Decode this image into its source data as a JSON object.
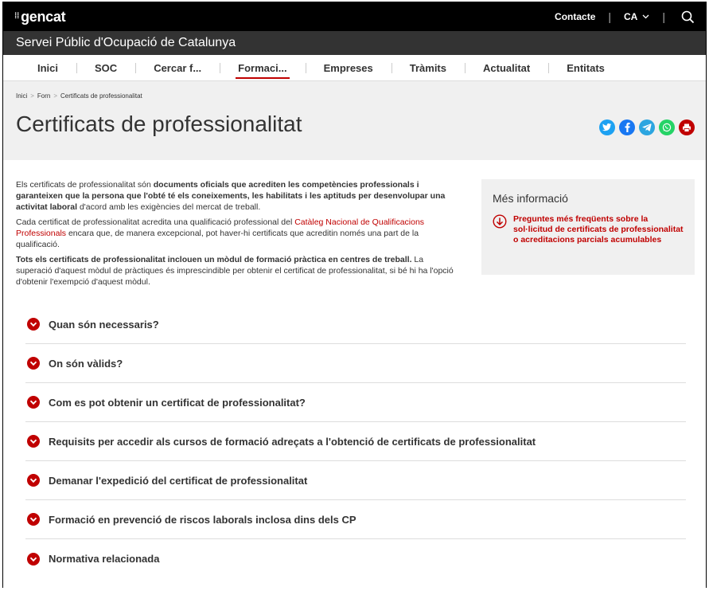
{
  "topbar": {
    "logo": "gencat",
    "contact": "Contacte",
    "language": "CA"
  },
  "subbar": {
    "title": "Servei Públic d'Ocupació de Catalunya"
  },
  "nav": {
    "items": [
      {
        "label": "Inici"
      },
      {
        "label": "SOC"
      },
      {
        "label": "Cercar f..."
      },
      {
        "label": "Formaci..."
      },
      {
        "label": "Empreses"
      },
      {
        "label": "Tràmits"
      },
      {
        "label": "Actualitat"
      },
      {
        "label": "Entitats"
      }
    ]
  },
  "breadcrumb": [
    "Inici",
    "Forn",
    "Certificats de professionalitat"
  ],
  "page_title": "Certificats de professionalitat",
  "share_colors": {
    "twitter": "#1da1f2",
    "facebook": "#1877f2",
    "telegram": "#2ca5e0",
    "whatsapp": "#25d366",
    "print": "#c00000"
  },
  "intro": {
    "p1_a": "Els certificats de professionalitat són ",
    "p1_b": "documents oficials que acrediten les competències professionals i garanteixen que la persona que l'obté té els coneixements, les habilitats i les aptituds per desenvolupar una activitat laboral",
    "p1_c": " d'acord amb les exigències del mercat de treball.",
    "p2_a": "Cada certificat de professionalitat acredita una qualificació professional del ",
    "p2_link": "Catàleg Nacional de Qualificacions Professionals",
    "p2_b": " encara que, de manera excepcional, pot haver-hi certificats que acreditin només una part de la qualificació.",
    "p3_a": "Tots els certificats de professionalitat inclouen un mòdul de formació pràctica en centres de treball.",
    "p3_b": " La superació d'aquest mòdul de pràctiques és imprescindible per obtenir el certificat de professionalitat, si bé hi ha l'opció d'obtenir l'exempció d'aquest mòdul."
  },
  "aside": {
    "title": "Més informació",
    "link": "Preguntes més freqüents sobre la sol·licitud de certificats de professionalitat o acreditacions parcials acumulables"
  },
  "accordion": [
    {
      "label": "Quan són necessaris?"
    },
    {
      "label": "On són vàlids?"
    },
    {
      "label": "Com es pot obtenir un certificat de professionalitat?"
    },
    {
      "label": "Requisits per accedir als cursos de formació adreçats a l'obtenció de certificats de professionalitat"
    },
    {
      "label": "Demanar l'expedició del certificat de professionalitat"
    },
    {
      "label": "Formació en prevenció de riscos laborals inclosa dins dels CP"
    },
    {
      "label": "Normativa relacionada"
    }
  ],
  "accent_color": "#c00000"
}
